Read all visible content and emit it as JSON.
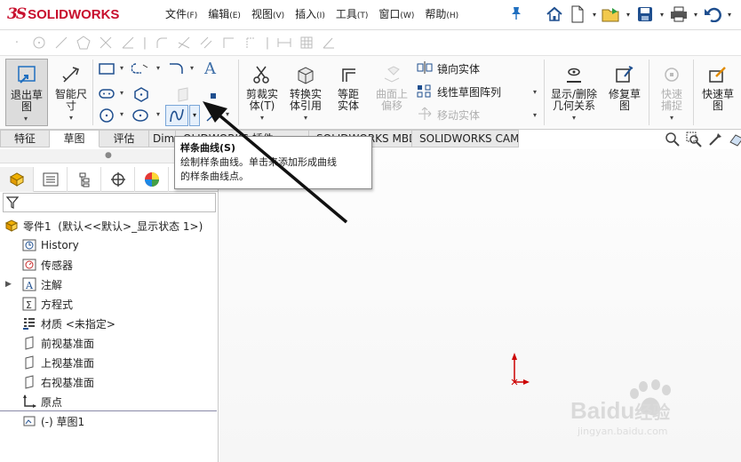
{
  "app": {
    "name": "SOLIDWORKS",
    "logo_prefix": "3S"
  },
  "menu": [
    {
      "label": "文件",
      "key": "(F)"
    },
    {
      "label": "编辑",
      "key": "(E)"
    },
    {
      "label": "视图",
      "key": "(V)"
    },
    {
      "label": "插入",
      "key": "(I)"
    },
    {
      "label": "工具",
      "key": "(T)"
    },
    {
      "label": "窗口",
      "key": "(W)"
    },
    {
      "label": "帮助",
      "key": "(H)"
    }
  ],
  "ribbon": {
    "exit_sketch": "退出草图",
    "smart_dimension": "智能尺寸",
    "trim_entities": "剪裁实体(T)",
    "convert_entities": "转换实体引用",
    "offset_entities": "等距实体",
    "offset_on_surface": "曲面上偏移",
    "mirror_entities": "镜向实体",
    "linear_pattern": "线性草图阵列",
    "move_entities": "移动实体",
    "display_relations": "显示/删除几何关系",
    "repair_sketch": "修复草图",
    "quick_snaps": "快速捕捉",
    "rapid_sketch": "快速草图"
  },
  "tabs": [
    "特征",
    "草图",
    "评估",
    "Dim",
    "SOLIDWORKS 插件",
    "SOLIDWORKS MBD",
    "SOLIDWORKS CAM"
  ],
  "tabs_display": [
    "特征",
    "草图",
    "评估",
    "Dim",
    "OLIDWORKS 插件",
    "SOLIDWORKS MBD",
    "SOLIDWORKS CAM"
  ],
  "active_tab": "草图",
  "tooltip": {
    "title": "样条曲线(S)",
    "line1": "绘制样条曲线。单击来添加形成曲线",
    "line2": "的样条曲线点。"
  },
  "tree": {
    "root": "零件1  (默认<<默认>_显示状态 1>)",
    "items": [
      {
        "label": "History",
        "icon": "history-icon"
      },
      {
        "label": "传感器",
        "icon": "sensor-icon"
      },
      {
        "label": "注解",
        "icon": "annotation-icon",
        "expandable": true
      },
      {
        "label": "方程式",
        "icon": "equation-icon"
      },
      {
        "label": "材质 <未指定>",
        "icon": "material-icon"
      },
      {
        "label": "前视基准面",
        "icon": "plane-icon"
      },
      {
        "label": "上视基准面",
        "icon": "plane-icon"
      },
      {
        "label": "右视基准面",
        "icon": "plane-icon"
      },
      {
        "label": "原点",
        "icon": "origin-icon"
      },
      {
        "label": "(-) 草图1",
        "icon": "sketch-icon"
      }
    ]
  },
  "watermark": {
    "brand": "Baidu",
    "cn": "经验",
    "url": "jingyan.baidu.com"
  },
  "colors": {
    "accent": "#c8102e",
    "blue": "#1f6fc0",
    "origin": "#cc0000"
  }
}
